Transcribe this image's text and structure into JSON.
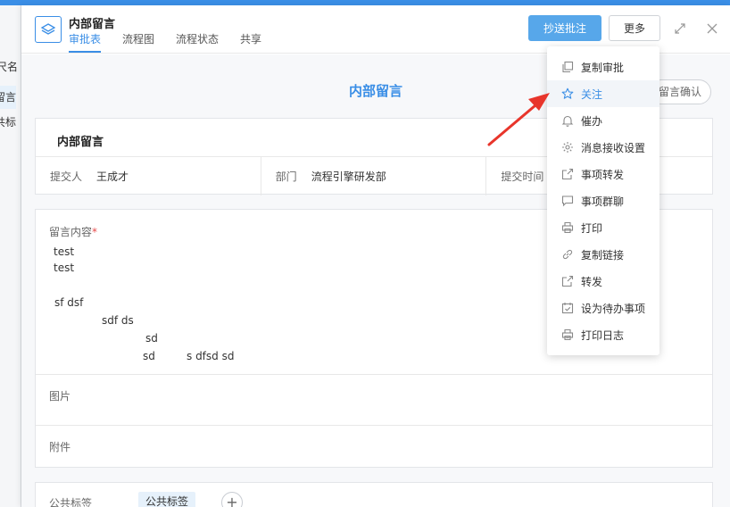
{
  "left_panel": {
    "items": [
      "尺名称",
      "留言",
      "共标"
    ]
  },
  "header": {
    "title": "内部留言",
    "tabs": [
      {
        "label": "审批表",
        "active": true
      },
      {
        "label": "流程图"
      },
      {
        "label": "流程状态"
      },
      {
        "label": "共享"
      }
    ],
    "primary_button": "抄送批注",
    "more_button": "更多",
    "icons": [
      "layers-icon",
      "expand-icon",
      "close-icon"
    ]
  },
  "form": {
    "title": "内部留言",
    "confirm_button": "留言确认",
    "card_title": "内部留言",
    "fields": [
      {
        "label": "提交人",
        "value": "王成才"
      },
      {
        "label": "部门",
        "value": "流程引擎研发部"
      },
      {
        "label": "提交时间",
        "value": ""
      }
    ],
    "message_label": "留言内容",
    "required_mark": "*",
    "message_lines": [
      "test",
      "test",
      "",
      "sf dsf",
      "sdf ds",
      "sd",
      "sd",
      "s dfsd sd"
    ],
    "image_label": "图片",
    "attachment_label": "附件",
    "tag_label": "公共标签",
    "tag_value": "公共标签",
    "tag_add": "+"
  },
  "menu": {
    "items": [
      {
        "label": "复制审批",
        "icon": "copy-icon"
      },
      {
        "label": "关注",
        "icon": "star-icon",
        "hover": true
      },
      {
        "label": "催办",
        "icon": "bell-icon"
      },
      {
        "label": "消息接收设置",
        "icon": "gear-icon"
      },
      {
        "label": "事项转发",
        "icon": "share-icon"
      },
      {
        "label": "事项群聊",
        "icon": "chat-icon"
      },
      {
        "label": "打印",
        "icon": "printer-icon"
      },
      {
        "label": "复制链接",
        "icon": "link-icon"
      },
      {
        "label": "转发",
        "icon": "forward-icon"
      },
      {
        "label": "设为待办事项",
        "icon": "calendar-check-icon"
      },
      {
        "label": "打印日志",
        "icon": "print-log-icon"
      }
    ]
  },
  "colors": {
    "accent": "#3a8ee6",
    "primary_button": "#57a7ea",
    "arrow": "#e8352b",
    "required": "#e84b4b"
  }
}
